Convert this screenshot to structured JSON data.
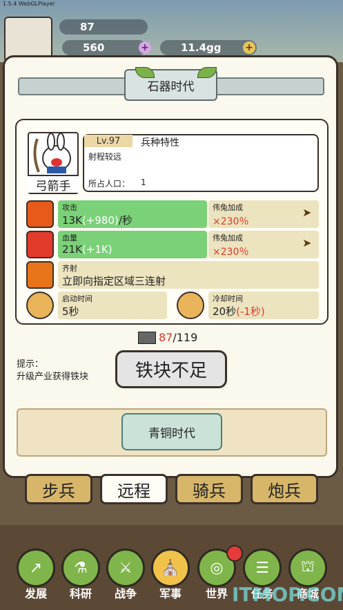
{
  "app": {
    "version": "1.5.4 WebGLPlayer"
  },
  "resources": {
    "iron": "87",
    "gems": "560",
    "gold": "11.4gg"
  },
  "era": {
    "current": "石器时代",
    "next": "青铜时代"
  },
  "unit": {
    "name": "弓箭手",
    "level": "Lv.97",
    "trait_title": "兵种特性",
    "trait_desc": "射程较远",
    "population_label": "所占人口：",
    "population_value": "1"
  },
  "stats": {
    "attack": {
      "label": "攻击",
      "value": "13K",
      "bonus": "(+980)",
      "unit": "/秒",
      "buff_label": "伟兔加成",
      "buff_value": "×230％"
    },
    "hp": {
      "label": "血量",
      "value": "21K",
      "bonus": "(+1K)",
      "buff_label": "伟兔加成",
      "buff_value": "×230％"
    },
    "skill": {
      "label": "齐射",
      "desc": "立即向指定区域三连射"
    },
    "start_time": {
      "label": "启动时间",
      "value": "5秒"
    },
    "cooldown": {
      "label": "冷却时间",
      "value": "20秒",
      "bonus": "(-1秒)"
    }
  },
  "upgrade": {
    "cost_have": "87",
    "cost_need": "/119",
    "hint_label": "提示：",
    "hint_text": "升级产业获得铁块",
    "button_label": "铁块不足"
  },
  "tabs": [
    "步兵",
    "远程",
    "骑兵",
    "炮兵"
  ],
  "nav": [
    "发展",
    "科研",
    "战争",
    "军事",
    "世界",
    "任务",
    "商城"
  ],
  "watermark": "ITMOP.COM"
}
